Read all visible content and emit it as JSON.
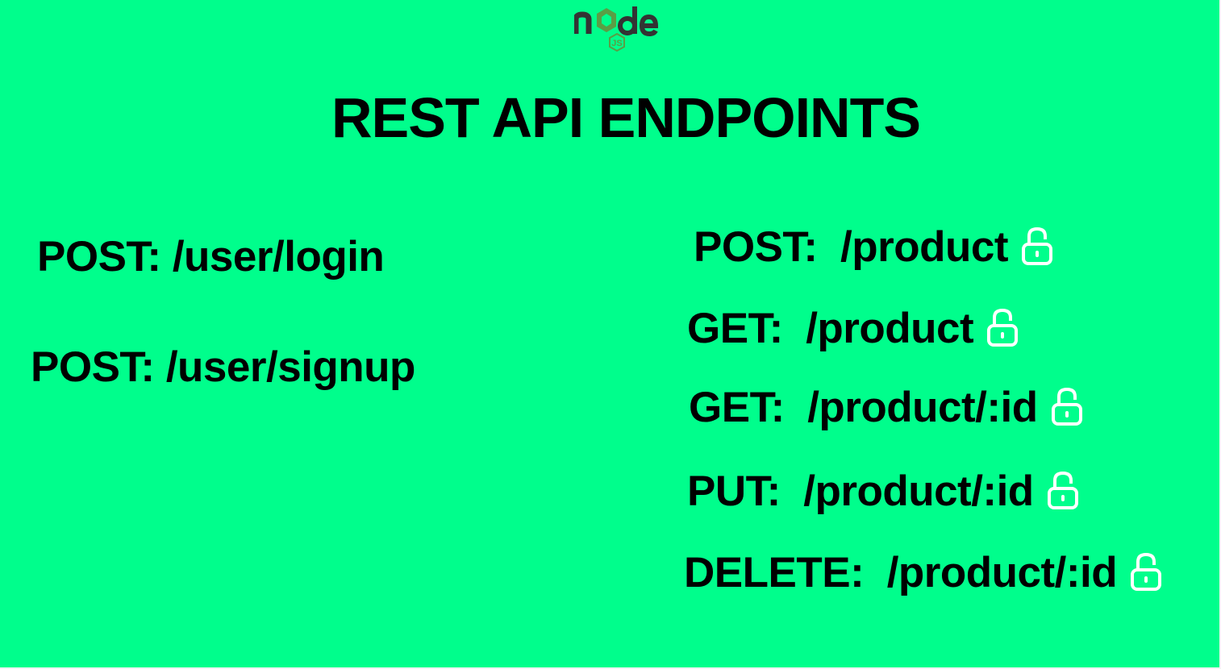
{
  "logo": {
    "text": "node",
    "badge": "JS",
    "icon": "nodejs-logo-icon",
    "color": "#333333",
    "accent": "#5a9e45"
  },
  "title": "REST API ENDPOINTS",
  "colors": {
    "background": "#00fe8c",
    "text": "#000000",
    "lock": "#ffffff"
  },
  "public_endpoints": [
    {
      "method": "POST:",
      "path": "/user/login"
    },
    {
      "method": "POST:",
      "path": "/user/signup"
    }
  ],
  "protected_endpoints": [
    {
      "method": "POST:",
      "path": "/product",
      "icon": "lock-icon"
    },
    {
      "method": "GET:",
      "path": "/product",
      "icon": "lock-icon"
    },
    {
      "method": "GET:",
      "path": "/product/:id",
      "icon": "lock-icon"
    },
    {
      "method": "PUT:",
      "path": "/product/:id",
      "icon": "lock-icon"
    },
    {
      "method": "DELETE:",
      "path": "/product/:id",
      "icon": "lock-icon"
    }
  ]
}
